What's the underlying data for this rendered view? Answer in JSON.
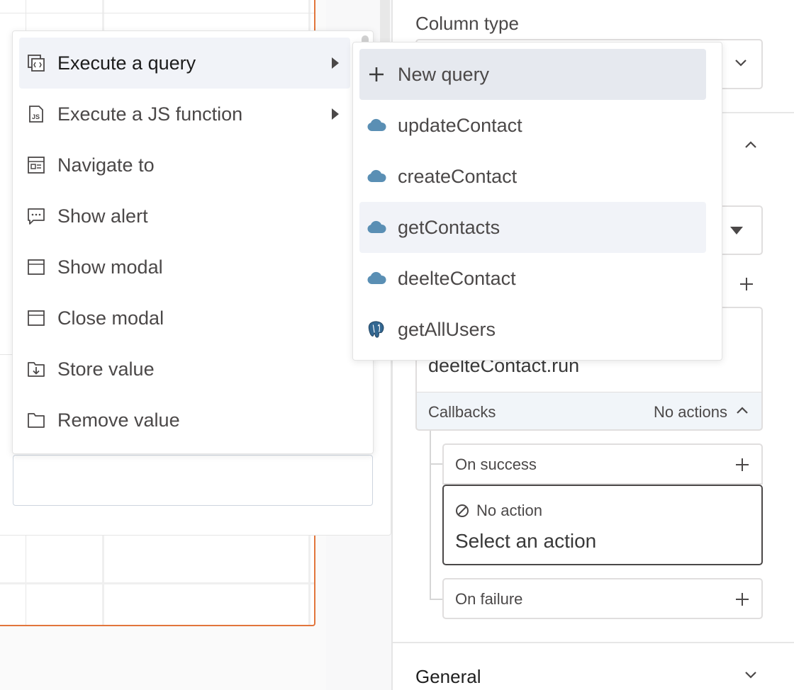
{
  "colors": {
    "accent": "#e2753c",
    "menu_hover": "#f1f3f8",
    "submenu_selected": "#e6e9ef",
    "api_cloud": "#5a8fb4",
    "postgres_blue": "#336791",
    "text": "#4b4848"
  },
  "action_menu": {
    "items": [
      {
        "label": "Execute a query",
        "icon": "query-icon",
        "has_submenu": true,
        "active": true
      },
      {
        "label": "Execute a JS function",
        "icon": "js-icon",
        "has_submenu": true
      },
      {
        "label": "Navigate to",
        "icon": "navigate-icon"
      },
      {
        "label": "Show alert",
        "icon": "alert-icon"
      },
      {
        "label": "Show modal",
        "icon": "modal-icon"
      },
      {
        "label": "Close modal",
        "icon": "modal-icon"
      },
      {
        "label": "Store value",
        "icon": "store-icon"
      },
      {
        "label": "Remove value",
        "icon": "folder-icon"
      }
    ]
  },
  "query_submenu": {
    "items": [
      {
        "label": "New query",
        "icon": "plus-icon"
      },
      {
        "label": "updateContact",
        "icon": "cloud-icon"
      },
      {
        "label": "createContact",
        "icon": "cloud-icon"
      },
      {
        "label": "getContacts",
        "icon": "cloud-icon"
      },
      {
        "label": "deelteContact",
        "icon": "cloud-icon"
      },
      {
        "label": "getAllUsers",
        "icon": "postgres-icon"
      }
    ]
  },
  "property_pane": {
    "column_type_label": "Column type",
    "action_code": "deelteContact.run",
    "callbacks": {
      "label": "Callbacks",
      "status": "No actions"
    },
    "on_success": {
      "label": "On success",
      "no_action": "No action",
      "select_placeholder": "Select an action"
    },
    "on_failure": {
      "label": "On failure"
    },
    "general_label": "General"
  }
}
